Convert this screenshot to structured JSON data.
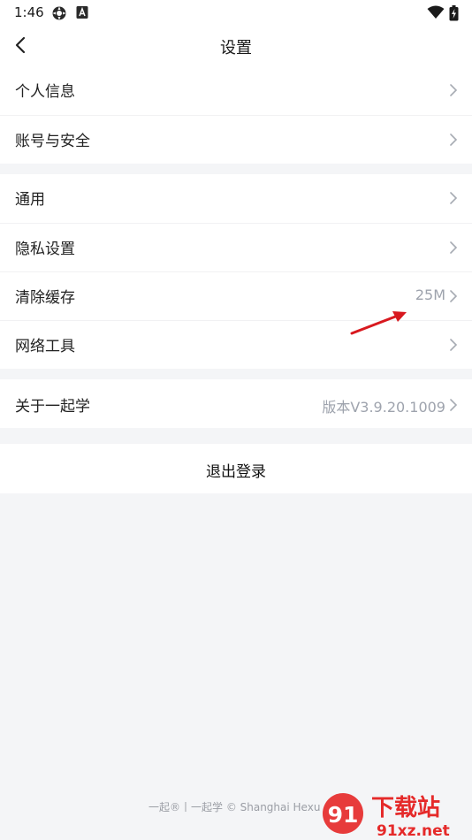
{
  "status": {
    "time": "1:46"
  },
  "nav": {
    "title": "设置"
  },
  "groups": [
    {
      "items": [
        {
          "label": "个人信息",
          "value": ""
        },
        {
          "label": "账号与安全",
          "value": ""
        }
      ]
    },
    {
      "items": [
        {
          "label": "通用",
          "value": ""
        },
        {
          "label": "隐私设置",
          "value": ""
        },
        {
          "label": "清除缓存",
          "value": "25M"
        },
        {
          "label": "网络工具",
          "value": ""
        }
      ]
    },
    {
      "items": [
        {
          "label": "关于一起学",
          "value": "版本V3.9.20.1009"
        }
      ]
    }
  ],
  "logout_label": "退出登录",
  "footer": {
    "text": "一起®丨一起学 © Shanghai Hexu"
  },
  "watermark": {
    "brand_glyph": "91",
    "brand_text": "下载站",
    "domain": "91xz.net"
  },
  "colors": {
    "page_bg": "#f4f5f7",
    "secondary_text": "#9ea3ad",
    "annotation_arrow": "#d8191f",
    "watermark_red": "#e52a2a"
  },
  "icons": [
    "back-chevron-icon",
    "right-chevron-icon",
    "gear-icon",
    "app-a-icon",
    "wifi-icon",
    "battery-icon"
  ]
}
